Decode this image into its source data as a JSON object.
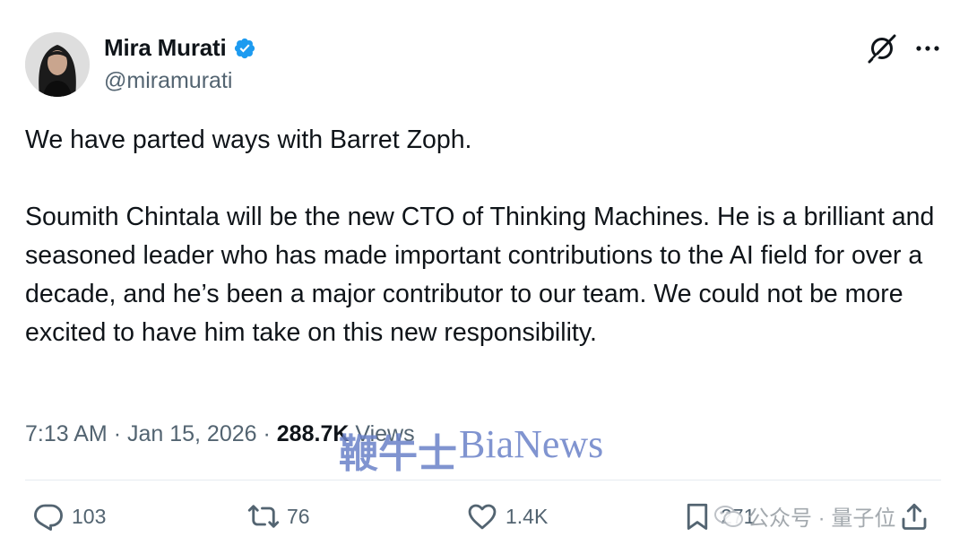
{
  "author": {
    "display_name": "Mira Murati",
    "handle": "@miramurati",
    "verified": true
  },
  "tweet": {
    "paragraphs": [
      "We have parted ways with Barret Zoph.",
      "Soumith Chintala will be the new CTO of Thinking Machines. He is a brilliant and seasoned leader who has made important contributions to the AI field for over a decade, and he’s been a major contributor to our team. We could not be more excited to have him take on this new responsibility."
    ],
    "time": "7:13 AM",
    "date": "Jan 15, 2026",
    "separator": "·",
    "views_count": "288.7K",
    "views_label": "Views"
  },
  "actions": {
    "replies": "103",
    "reposts": "76",
    "likes": "1.4K",
    "bookmarks": "271"
  },
  "watermarks": {
    "site_cn": "鞭牛士",
    "site_en": "BiaNews",
    "wechat": "公众号 · 量子位"
  },
  "colors": {
    "text_primary": "#0f1419",
    "text_secondary": "#536471",
    "verified_blue": "#1d9bf0",
    "watermark_blue": "#6b82c8",
    "divider": "#e6ecf0"
  },
  "icons": {
    "verified": "verified-badge-icon",
    "grok": "grok-icon",
    "more": "more-options-icon",
    "reply": "reply-icon",
    "repost": "repost-icon",
    "like": "like-icon",
    "bookmark": "bookmark-icon",
    "share": "share-icon"
  }
}
